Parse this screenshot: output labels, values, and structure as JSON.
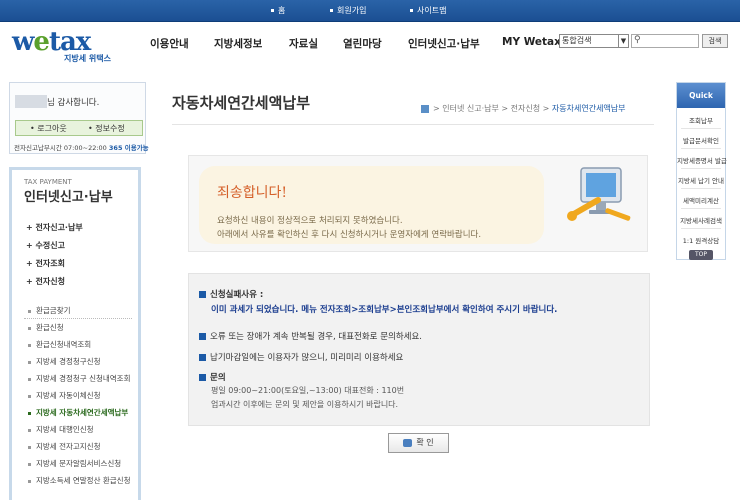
{
  "top_links": [
    "홈",
    "회원가입",
    "사이트맵"
  ],
  "logo": {
    "text": "wetax",
    "sub": "지방세 위택스"
  },
  "nav": [
    "이용안내",
    "지방세정보",
    "자료실",
    "열린마당",
    "인터넷신고·납부",
    "MY Wetax"
  ],
  "search": {
    "select_value": "통합검색",
    "button": "검색"
  },
  "user": {
    "greeting": "님 감사합니다.",
    "logout": "• 로그아웃",
    "edit": "• 정보수정",
    "hours_prefix": "전자신고납부시간 07:00~22:00",
    "hours_highlight": "365 이용가능"
  },
  "lnb": {
    "caption": "TAX PAYMENT",
    "title": "인터넷신고·납부",
    "main": [
      "+ 전자신고·납부",
      "+ 수정신고",
      "+ 전자조회",
      "+ 전자신청"
    ],
    "sub": [
      "환급금찾기",
      "환급신청",
      "환급신청내역조회",
      "지방세 경정청구신청",
      "지방세 경정청구 신청내역조회",
      "지방세 자동이체신청",
      "지방세 자동차세연간세액납부",
      "지방세 대행인신청",
      "지방세 전자고지신청",
      "지방세 문자알림서비스신청",
      "지방소득세 연말정산 환급신청"
    ],
    "active_index": 6
  },
  "page": {
    "title": "자동차세연간세액납부",
    "breadcrumb": [
      "인터넷 신고·납부",
      "전자신청",
      "자동차세연간세액납부"
    ]
  },
  "error": {
    "sorry": "죄송합니다!",
    "line1": "요청하신 내용이 정상적으로 처리되지 못하였습니다.",
    "line2": "아래에서 사유를 확인하신 후 다시 신청하시거나 운영자에게 연락바랍니다."
  },
  "info": {
    "fail_label": "신청실패사유 :",
    "fail_text": "이미 과세가 되었습니다. 메뉴 전자조회>조회납부>본인조회납부에서 확인하여 주시기 바랍니다.",
    "repeat": "오류 또는 장애가 계속 반복될 경우, 대표전화로 문의하세요.",
    "deadline": "납기마감일에는 이용자가 많으니, 미리미리 이용하세요",
    "contact_label": "문의",
    "contact_line1": "평일 09:00~21:00(토요일,~13:00) 대표전화 : 110번",
    "contact_line2": "업과시간 이후에는 문의 및 제안을 이용하시기 바랍니다."
  },
  "ok_button": "확 인",
  "quick": {
    "header": "Quick Menu",
    "items": [
      "조회납부",
      "발급문서확인",
      "지방세증명서 발급",
      "지방세 납기 안내",
      "세액미리계산",
      "지방세사례검색",
      "1:1 원격상담"
    ],
    "top": "TOP"
  }
}
